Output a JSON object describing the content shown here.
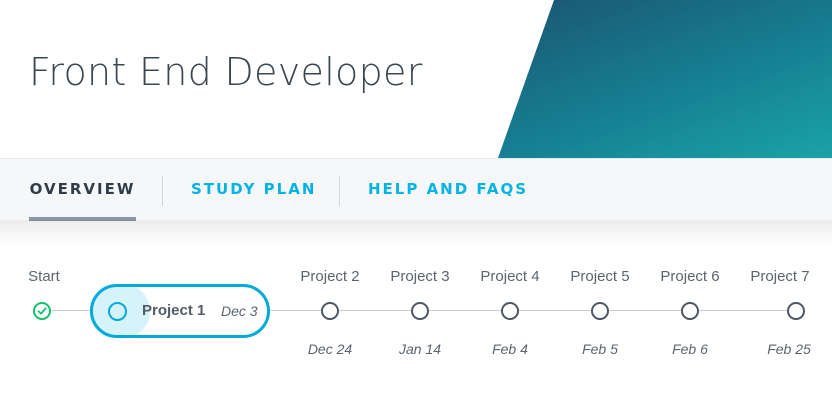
{
  "header": {
    "title": "Front End Developer"
  },
  "tabs": [
    {
      "label": "OVERVIEW",
      "active": true
    },
    {
      "label": "STUDY PLAN",
      "active": false
    },
    {
      "label": "HELP AND FAQS",
      "active": false
    }
  ],
  "timeline": {
    "start": {
      "label": "Start",
      "status": "complete"
    },
    "current": {
      "label": "Project 1",
      "date": "Dec 3"
    },
    "milestones": [
      {
        "label": "Project 2",
        "date": "Dec 24"
      },
      {
        "label": "Project 3",
        "date": "Jan 14"
      },
      {
        "label": "Project 4",
        "date": "Feb 4"
      },
      {
        "label": "Project 5",
        "date": "Feb 5"
      },
      {
        "label": "Project 6",
        "date": "Feb 6"
      },
      {
        "label": "Project 7",
        "date": "Feb 25"
      }
    ]
  },
  "colors": {
    "accent": "#02b3e4",
    "complete": "#15c26b",
    "banner": "#167f93"
  }
}
